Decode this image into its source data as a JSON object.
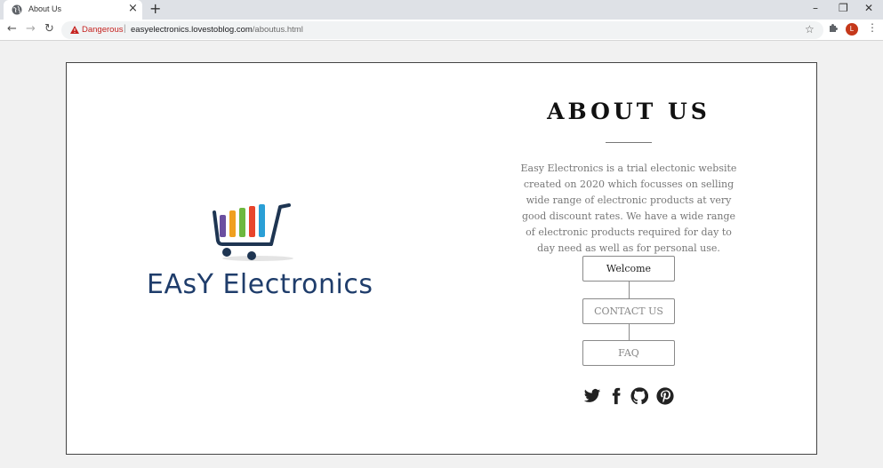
{
  "browser": {
    "tab_title": "About Us",
    "tab_close": "×",
    "new_tab": "+",
    "window_controls": {
      "minimize": "–",
      "restore": "❐",
      "close": "✕"
    },
    "nav": {
      "back": "←",
      "forward": "→",
      "reload": "↻"
    },
    "security_label": "Dangerous",
    "separator": "|",
    "url_host": "easyelectronics.lovestoblog.com",
    "url_path": "/aboutus.html",
    "star": "☆",
    "avatar_letter": "L",
    "menu": "⋮"
  },
  "page": {
    "logo_text": "EAsY Electronics",
    "title": "ABOUT US",
    "description": "Easy Electronics is a trial electonic website created on 2020 which focusses on selling wide range of electronic products at very good discount rates. We have a wide range of electronic products required for day to day need as well as for personal use.",
    "menu": [
      {
        "label": "Welcome"
      },
      {
        "label": "CONTACT US"
      },
      {
        "label": "FAQ"
      }
    ],
    "social_icons": [
      "twitter-icon",
      "facebook-icon",
      "github-icon",
      "pinterest-icon"
    ]
  },
  "colors": {
    "danger": "#c5221f",
    "logo_text": "#1f3d6b",
    "avatar": "#c5381a",
    "cart_bars": [
      "#6b4fa0",
      "#f0a020",
      "#6db83f",
      "#e8452c",
      "#2a9fd6"
    ]
  }
}
